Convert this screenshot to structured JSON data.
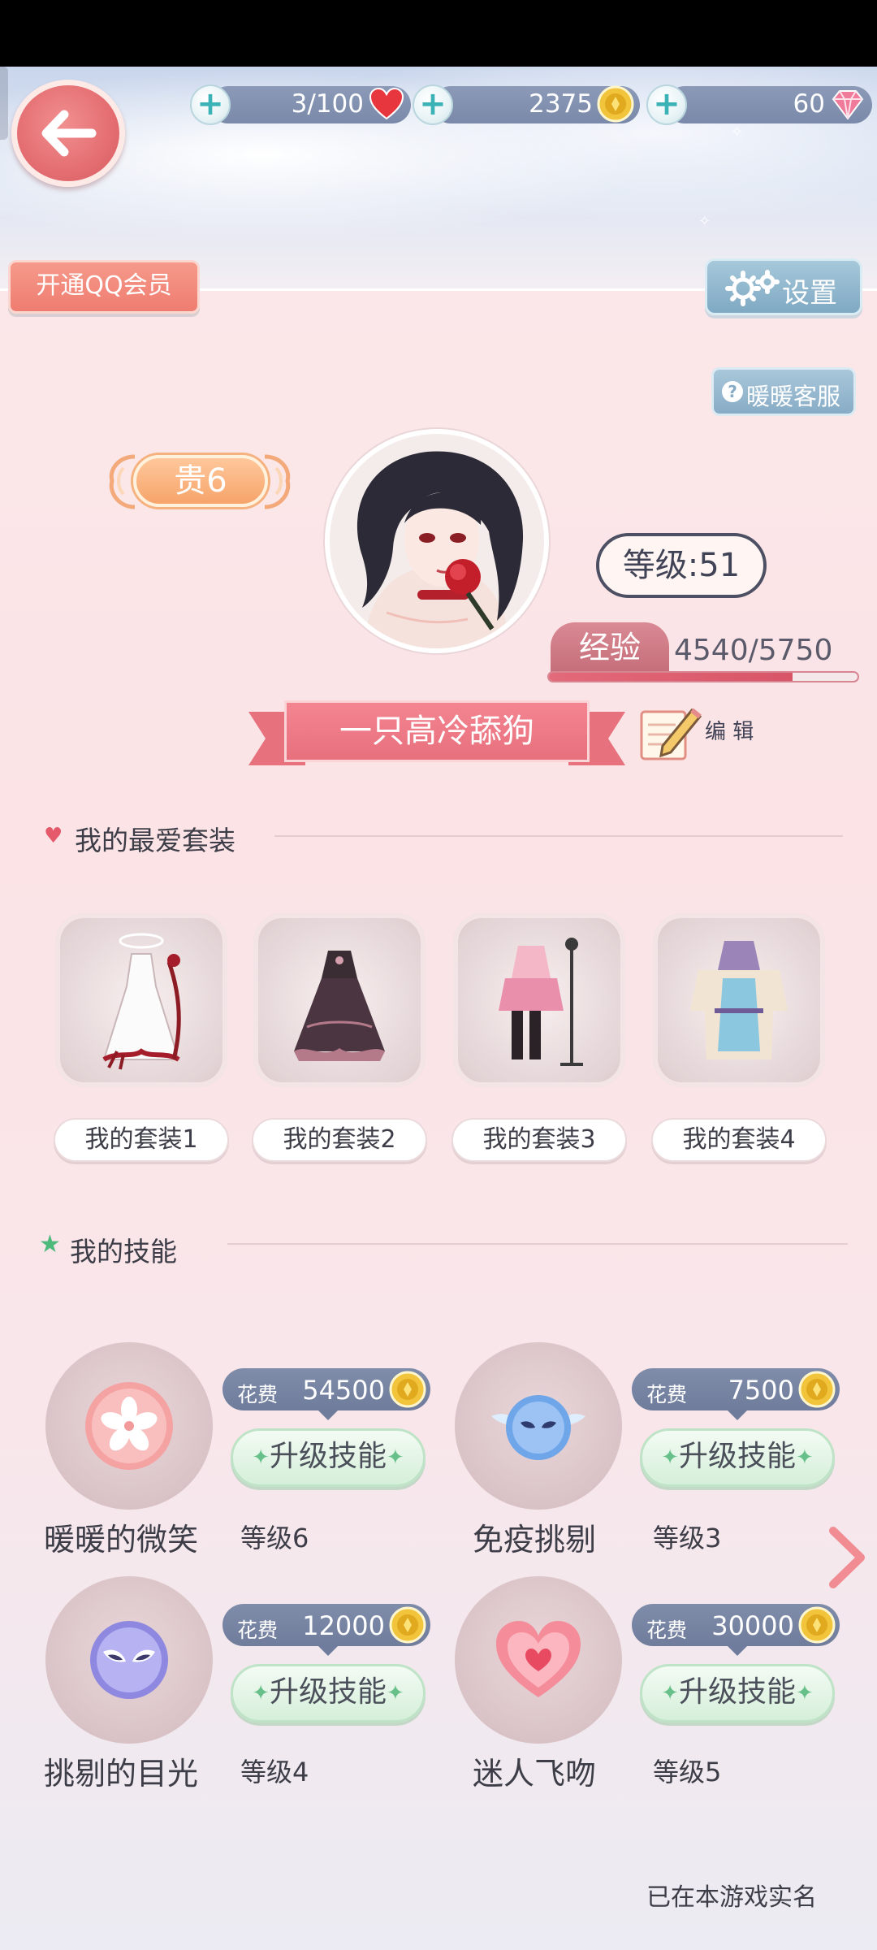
{
  "resources": {
    "stamina": {
      "value": "3/100",
      "icon": "heart-icon"
    },
    "gold": {
      "value": "2375",
      "icon": "gold-coin-icon"
    },
    "diamond": {
      "value": "60",
      "icon": "diamond-icon"
    }
  },
  "header": {
    "qq_member_label": "开通QQ会员",
    "settings_label": "设置",
    "service_label": "暖暖客服"
  },
  "profile": {
    "vip_label": "贵6",
    "level_text": "等级:51",
    "exp_label": "经验",
    "exp_value": "4540/5750",
    "exp_fraction": 0.79,
    "nickname": "一只高冷舔狗",
    "edit_label": "编 辑"
  },
  "favorites": {
    "title": "我的最爱套装",
    "outfits": [
      {
        "label": "我的套装1"
      },
      {
        "label": "我的套装2"
      },
      {
        "label": "我的套装3"
      },
      {
        "label": "我的套装4"
      }
    ]
  },
  "skills": {
    "title": "我的技能",
    "cost_label": "花费",
    "upgrade_label": "升级技能",
    "items": [
      {
        "name": "暖暖的微笑",
        "level": "等级6",
        "cost": "54500",
        "icon": "sakura-icon"
      },
      {
        "name": "免疫挑剔",
        "level": "等级3",
        "cost": "7500",
        "icon": "winged-mask-icon"
      },
      {
        "name": "挑剔的目光",
        "level": "等级4",
        "cost": "12000",
        "icon": "purple-mask-icon"
      },
      {
        "name": "迷人飞吻",
        "level": "等级5",
        "cost": "30000",
        "icon": "heart-orb-icon"
      }
    ]
  },
  "footer": {
    "note": "已在本游戏实名"
  },
  "colors": {
    "accent_pink": "#e8707d",
    "slate_pill": "#7a89a9",
    "green_button": "#d5efd9"
  }
}
